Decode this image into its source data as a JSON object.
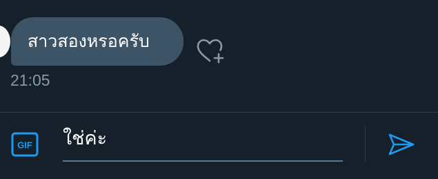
{
  "message": {
    "text": "สาวสองหรอครับ",
    "time": "21:05"
  },
  "composer": {
    "value": "ใช่ค่ะ",
    "gif_label": "GIF"
  },
  "colors": {
    "background": "#15202b",
    "bubble": "#3d5466",
    "accent": "#1d9bf0",
    "muted": "#8899a6"
  },
  "icons": {
    "like": "heart-plus-icon",
    "gif": "gif-icon",
    "send": "send-icon"
  }
}
